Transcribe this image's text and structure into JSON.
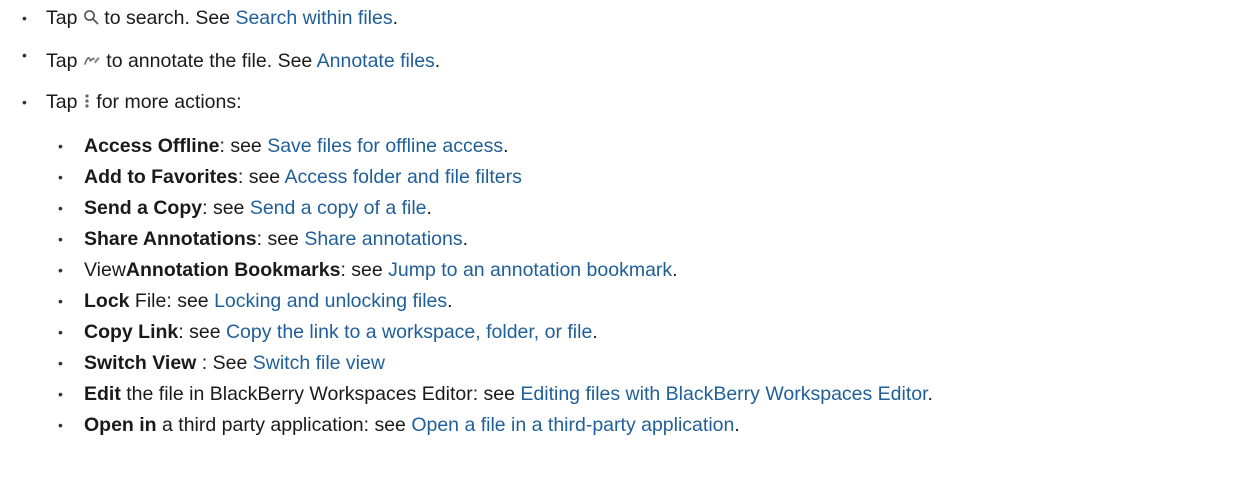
{
  "items": [
    {
      "pre": "Tap ",
      "post": " to search. See ",
      "link": "Search within files",
      "tail": "."
    },
    {
      "pre": "Tap ",
      "post": " to annotate the file. See ",
      "link": "Annotate files",
      "tail": "."
    },
    {
      "pre": "Tap ",
      "post": " for more actions:"
    }
  ],
  "actions": [
    {
      "bold": "Access Offline",
      "text": ": see ",
      "link": "Save files for offline access",
      "tail": "."
    },
    {
      "bold": "Add to Favorites",
      "text": ": see ",
      "link": "Access folder and file filters",
      "tail": ""
    },
    {
      "bold": "Send a Copy",
      "text": ": see ",
      "link": "Send a copy of a file",
      "tail": "."
    },
    {
      "bold": "Share Annotations",
      "text": ": see ",
      "link": "Share annotations",
      "tail": "."
    },
    {
      "pre": "View",
      "bold": "Annotation Bookmarks",
      "text": ": see ",
      "link": "Jump to an annotation bookmark",
      "tail": "."
    },
    {
      "bold": "Lock",
      "text": " File: see ",
      "link": "Locking and unlocking files",
      "tail": "."
    },
    {
      "bold": "Copy Link",
      "text": ": see ",
      "link": "Copy the link to a workspace, folder, or file",
      "tail": "."
    },
    {
      "bold": "Switch View",
      "text": " : See ",
      "link": "Switch file view",
      "tail": ""
    },
    {
      "bold": "Edit",
      "text": " the file in BlackBerry Workspaces Editor: see ",
      "link": "Editing files with BlackBerry Workspaces Editor",
      "tail": "."
    },
    {
      "bold": "Open in",
      "text": " a third party application: see ",
      "link": "Open a file in a third-party application",
      "tail": "."
    }
  ],
  "icons": {
    "search": "search-icon",
    "annotate": "annotate-icon",
    "more": "more-vertical-icon"
  },
  "colors": {
    "link": "#1f5f99",
    "text": "#1a1a1a"
  },
  "bullet_char": "•"
}
